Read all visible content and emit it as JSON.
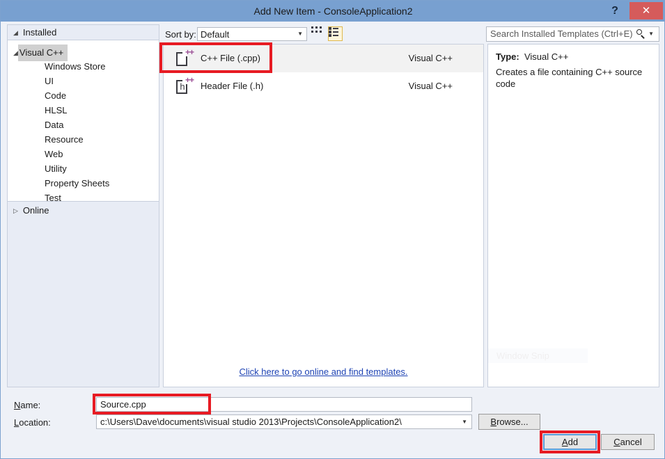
{
  "window": {
    "title": "Add New Item - ConsoleApplication2",
    "help_label": "?",
    "close_label": "✕"
  },
  "sidebar": {
    "header": {
      "label": "Installed",
      "triangle": "◢"
    },
    "root": {
      "label": "Visual C++",
      "triangle": "◢"
    },
    "items": [
      {
        "label": "Windows Store"
      },
      {
        "label": "UI"
      },
      {
        "label": "Code"
      },
      {
        "label": "HLSL"
      },
      {
        "label": "Data"
      },
      {
        "label": "Resource"
      },
      {
        "label": "Web"
      },
      {
        "label": "Utility"
      },
      {
        "label": "Property Sheets"
      },
      {
        "label": "Test"
      }
    ],
    "online": {
      "label": "Online",
      "triangle": "▷"
    }
  },
  "toolbar": {
    "sort_label": "Sort by:",
    "sort_value": "Default",
    "sort_arrow": "▼",
    "view_grid_icon": "grid-view-icon",
    "view_list_icon": "list-view-icon",
    "view_selected": "list"
  },
  "search": {
    "placeholder": "Search Installed Templates (Ctrl+E)",
    "icon": "search-icon",
    "dropdown_arrow": "▼"
  },
  "templates": {
    "items": [
      {
        "name": "C++ File (.cpp)",
        "category": "Visual C++",
        "icon": "cpp-file-icon",
        "icon_badge": "++",
        "selected": true
      },
      {
        "name": "Header File (.h)",
        "category": "Visual C++",
        "icon": "header-file-icon",
        "icon_letter": "h",
        "icon_badge": "++",
        "selected": false
      }
    ],
    "online_link": "Click here to go online and find templates."
  },
  "details": {
    "type_label": "Type:",
    "type_value": "Visual C++",
    "description": "Creates a file containing C++ source code",
    "watermark": "Window Snip"
  },
  "form": {
    "name_label_pre": "",
    "name_label_acc": "N",
    "name_label_post": "ame:",
    "name_value": "Source.cpp",
    "location_label_acc": "L",
    "location_label_post": "ocation:",
    "location_value": "c:\\Users\\Dave\\documents\\visual studio 2013\\Projects\\ConsoleApplication2\\",
    "location_arrow": "▼"
  },
  "buttons": {
    "browse_acc": "B",
    "browse_post": "rowse...",
    "add_acc": "A",
    "add_post": "dd",
    "cancel_acc": "C",
    "cancel_post": "ancel"
  },
  "colors": {
    "titlebar": "#78a0d0",
    "close": "#d55b5b",
    "annotation": "#e71b23",
    "link": "#1f44b4",
    "accent_purple": "#9b4f96",
    "selected_toggle_border": "#e0b84c",
    "default_button_focus": "#5a9ad6"
  }
}
